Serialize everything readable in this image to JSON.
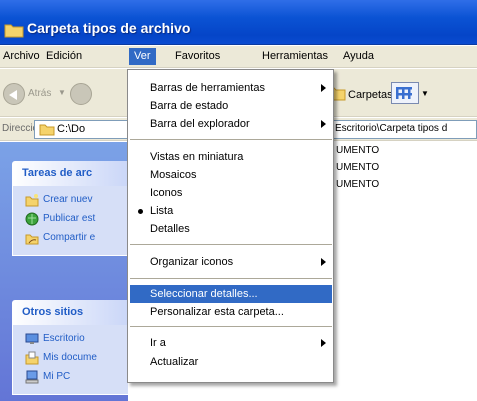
{
  "window": {
    "title": "Carpeta tipos de archivo"
  },
  "menubar": {
    "items": [
      "Archivo",
      "Edición",
      "Ver",
      "Favoritos",
      "Herramientas",
      "Ayuda"
    ],
    "active": "Ver"
  },
  "toolbar": {
    "back_label": "Atrás",
    "folders_label": "Carpetas"
  },
  "address": {
    "label": "Dirección",
    "value": "C:\\Do",
    "tail": "Escritorio\\Carpeta tipos d"
  },
  "tasks": {
    "title": "Tareas de arc",
    "items": [
      {
        "label": "Crear nuev",
        "icon": "new-folder-icon"
      },
      {
        "label": "Publicar est",
        "icon": "publish-web-icon"
      },
      {
        "label": "Compartir e",
        "icon": "share-folder-icon"
      }
    ]
  },
  "places": {
    "title": "Otros sitios",
    "items": [
      {
        "label": "Escritorio",
        "icon": "desktop-icon"
      },
      {
        "label": "Mis docume",
        "icon": "my-documents-icon"
      },
      {
        "label": "Mi PC",
        "icon": "my-computer-icon"
      }
    ]
  },
  "files": [
    "UMENTO",
    "UMENTO",
    "UMENTO"
  ],
  "view_menu": {
    "items": [
      {
        "label": "Barras de herramientas",
        "submenu": true
      },
      {
        "label": "Barra de estado"
      },
      {
        "label": "Barra del explorador",
        "submenu": true
      },
      {
        "label": "Vistas en miniatura"
      },
      {
        "label": "Mosaicos"
      },
      {
        "label": "Iconos"
      },
      {
        "label": "Lista",
        "checked": true
      },
      {
        "label": "Detalles"
      },
      {
        "label": "Organizar iconos",
        "submenu": true
      },
      {
        "label": "Seleccionar detalles...",
        "highlighted": true
      },
      {
        "label": "Personalizar esta carpeta..."
      },
      {
        "label": "Ir a",
        "submenu": true
      },
      {
        "label": "Actualizar"
      }
    ]
  },
  "colors": {
    "selection": "#316ac5",
    "titlebar": "#0b53d4",
    "task_link": "#215dc6"
  }
}
